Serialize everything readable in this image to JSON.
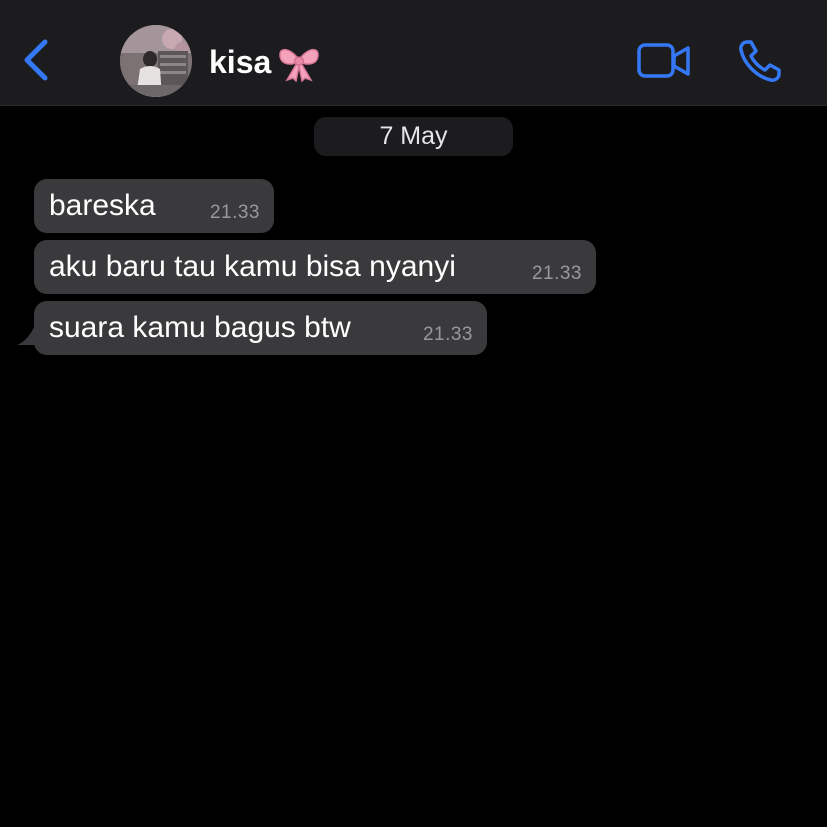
{
  "header": {
    "back_icon": "chevron-left-icon",
    "avatar": "contact-avatar",
    "contact_name": "kisa",
    "name_emoji": "ribbon-bow-icon",
    "video_icon": "video-camera-icon",
    "phone_icon": "phone-icon",
    "accent_color": "#3478f6"
  },
  "chat": {
    "date_label": "7 May",
    "messages": [
      {
        "text": "bareska",
        "time": "21.33"
      },
      {
        "text": "aku baru tau kamu bisa nyanyi",
        "time": "21.33"
      },
      {
        "text": "suara kamu bagus btw",
        "time": "21.33"
      }
    ]
  },
  "colors": {
    "background": "#000000",
    "header": "#1c1c1e",
    "bubble": "#3a3a3c",
    "timestamp": "#98989d"
  }
}
